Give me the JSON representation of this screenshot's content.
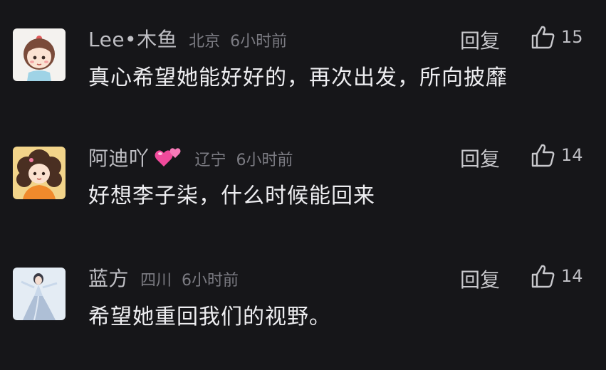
{
  "comments": [
    {
      "username": "Lee•木鱼",
      "location": "北京",
      "time": "6小时前",
      "reply": "回复",
      "likes": "15",
      "text": "真心希望她能好好的，再次出发，所向披靡",
      "avatar": "cartoon-girl-avatar"
    },
    {
      "username": "阿迪吖",
      "username_emoji": "two-hearts-icon",
      "location": "辽宁",
      "time": "6小时前",
      "reply": "回复",
      "likes": "14",
      "text": "好想李子柒，什么时候能回来",
      "avatar": "curly-hair-girl-avatar"
    },
    {
      "username": "蓝方",
      "location": "四川",
      "time": "6小时前",
      "reply": "回复",
      "likes": "14",
      "text": "希望她重回我们的视野。",
      "avatar": "dancer-avatar"
    }
  ]
}
